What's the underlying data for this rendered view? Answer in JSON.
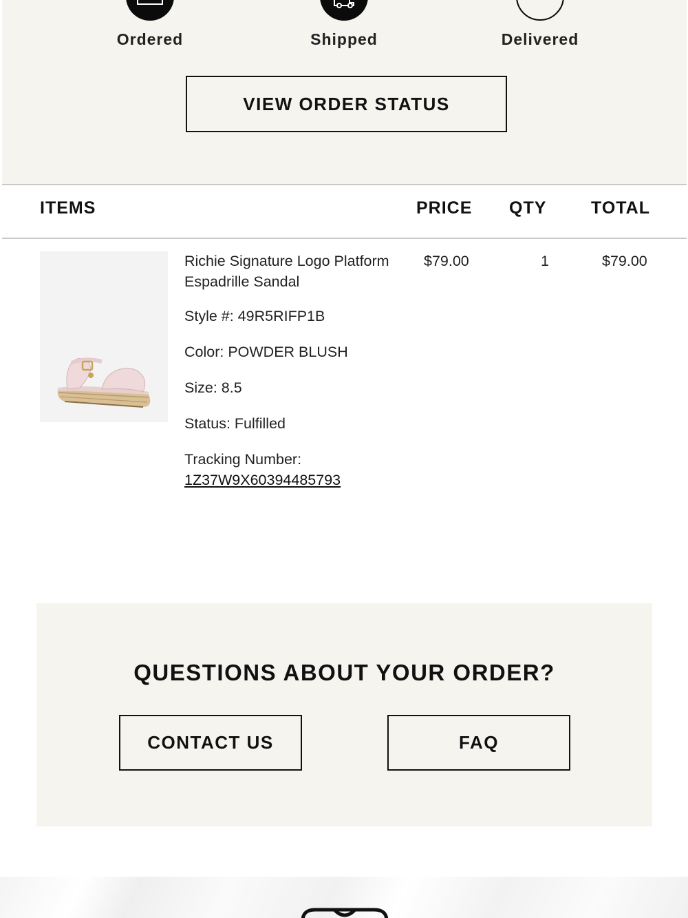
{
  "tracker": {
    "steps": [
      {
        "label": "Ordered",
        "icon": "box-icon",
        "state": "complete"
      },
      {
        "label": "Shipped",
        "icon": "truck-icon",
        "state": "complete"
      },
      {
        "label": "Delivered",
        "icon": "circle-outline-icon",
        "state": "pending"
      }
    ],
    "view_status_label": "VIEW ORDER STATUS"
  },
  "table": {
    "headers": {
      "items": "ITEMS",
      "price": "PRICE",
      "qty": "QTY",
      "total": "TOTAL"
    },
    "rows": [
      {
        "name": "Richie Signature Logo Platform Espadrille Sandal",
        "style": "Style #: 49R5RIFP1B",
        "color": "Color: POWDER BLUSH",
        "size": "Size: 8.5",
        "status": "Status: Fulfilled",
        "tracking_label": "Tracking Number:",
        "tracking_number": "1Z37W9X60394485793",
        "price": "$79.00",
        "qty": "1",
        "total": "$79.00",
        "image_icon": "sandal-image"
      }
    ]
  },
  "questions": {
    "title": "QUESTIONS ABOUT YOUR ORDER?",
    "contact_label": "CONTACT US",
    "faq_label": "FAQ"
  },
  "colors": {
    "panel": "#f6f4ee",
    "ink": "#111111",
    "rule": "#c9c9c9"
  }
}
